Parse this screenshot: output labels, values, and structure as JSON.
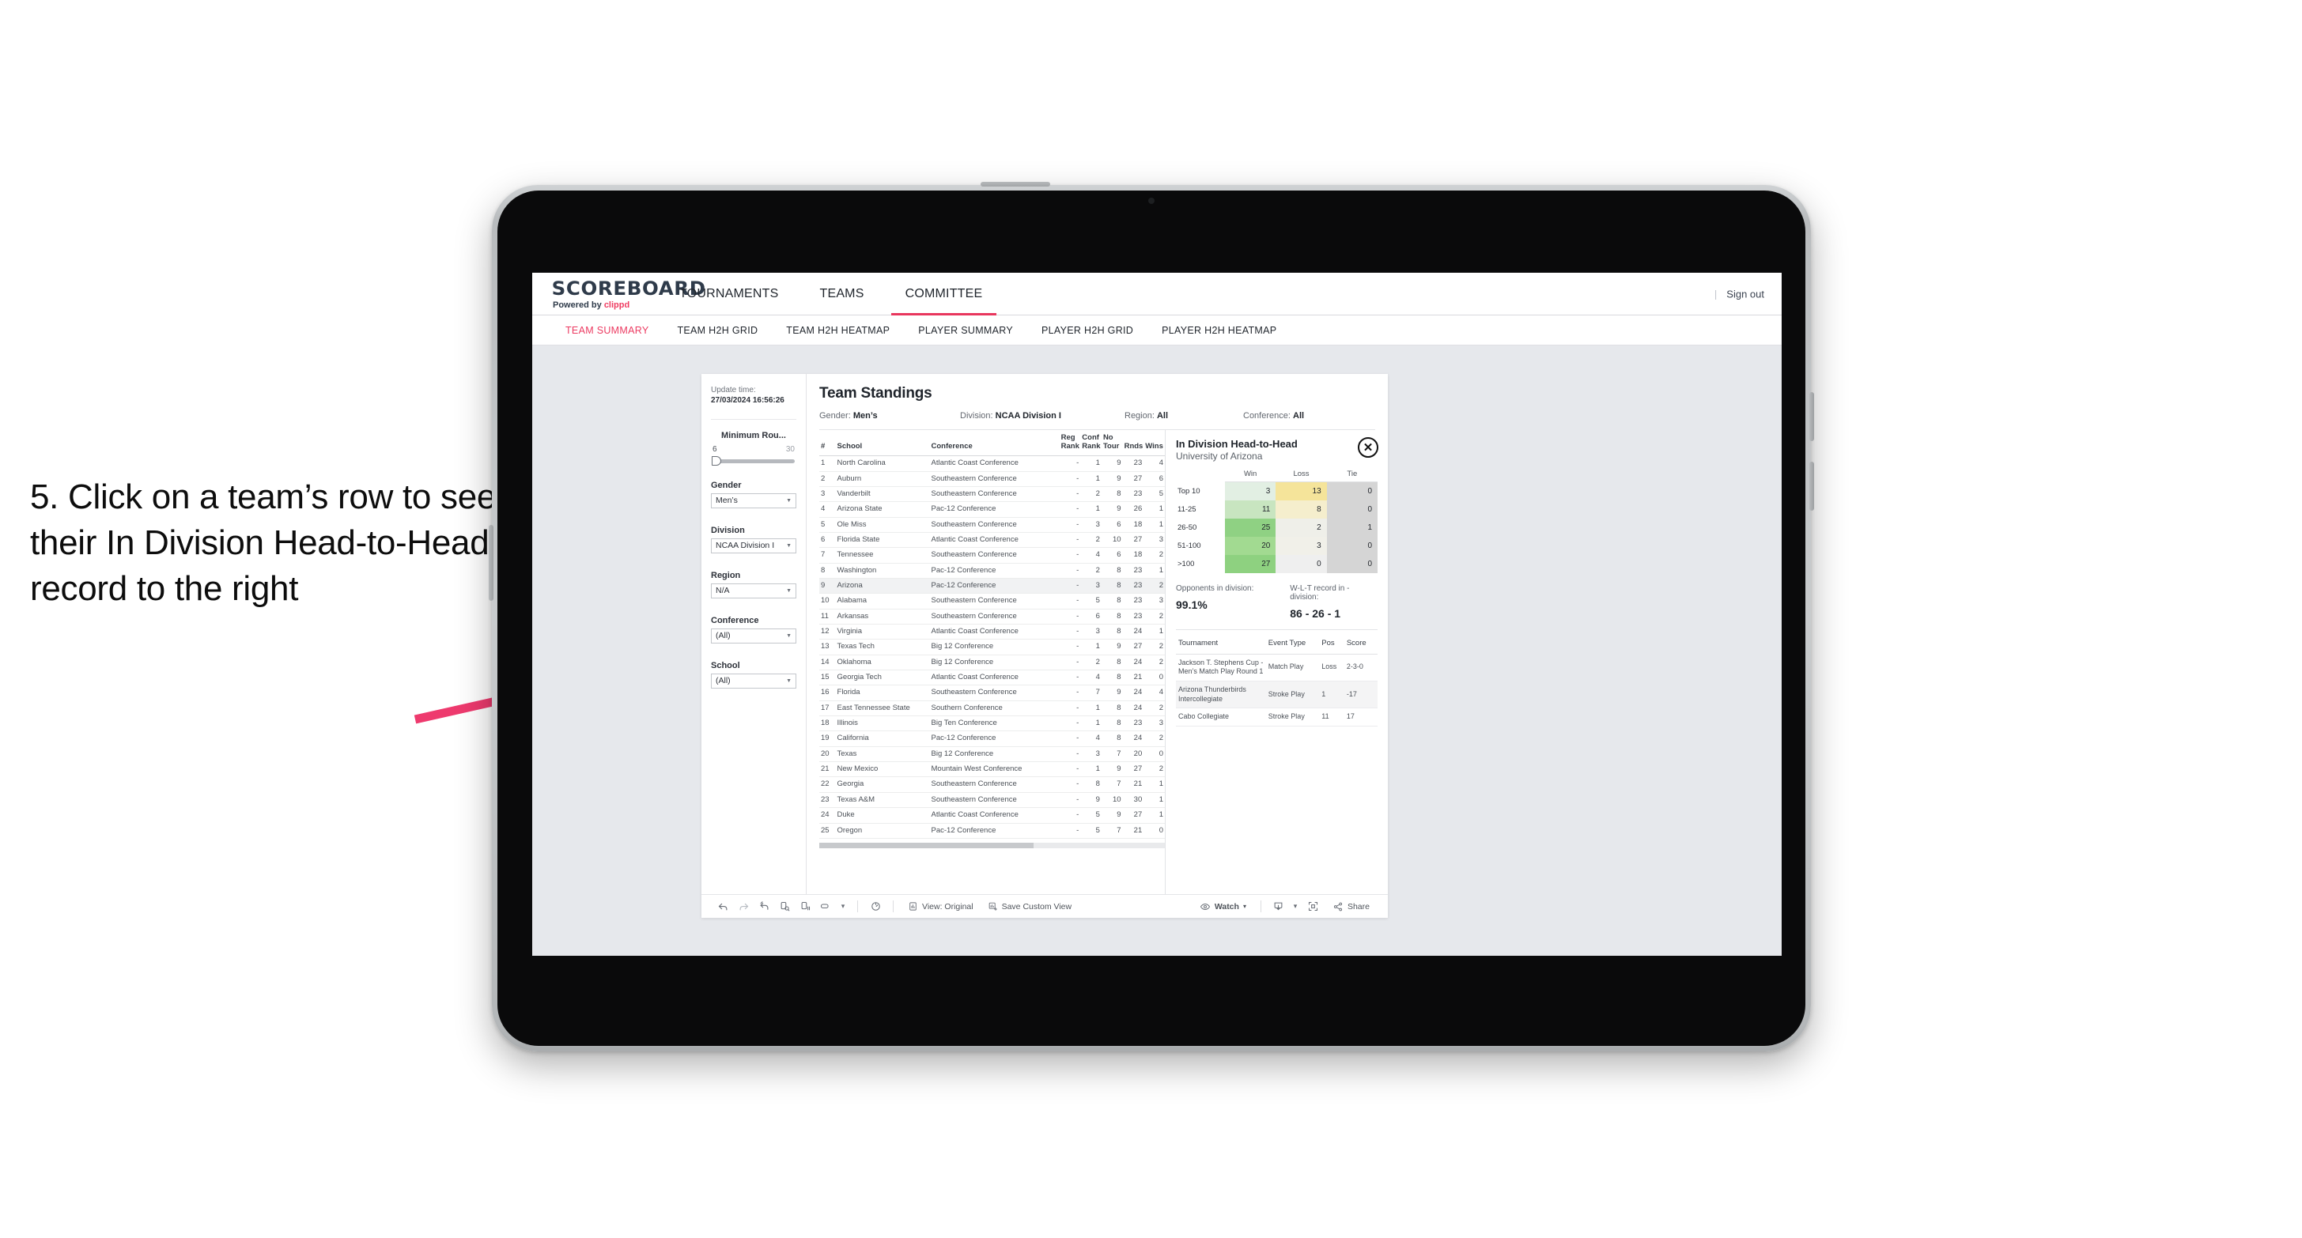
{
  "annotation": {
    "text": "5. Click on a team’s row to see their In Division Head-to-Head record to the right",
    "arrow_color": "#ee3a6e"
  },
  "topnav": {
    "logo_main": "SCOREBOARD",
    "logo_sub_pre": "Powered by",
    "logo_sub_brand": "clippd",
    "items": [
      {
        "label": "TOURNAMENTS",
        "active": false
      },
      {
        "label": "TEAMS",
        "active": false
      },
      {
        "label": "COMMITTEE",
        "active": true
      }
    ],
    "separator": "|",
    "signout": "Sign out",
    "accent": "#e8365d"
  },
  "subnav": {
    "items": [
      {
        "label": "TEAM SUMMARY",
        "active": true
      },
      {
        "label": "TEAM H2H GRID",
        "active": false
      },
      {
        "label": "TEAM H2H HEATMAP",
        "active": false
      },
      {
        "label": "PLAYER SUMMARY",
        "active": false
      },
      {
        "label": "PLAYER H2H GRID",
        "active": false
      },
      {
        "label": "PLAYER H2H HEATMAP",
        "active": false
      }
    ]
  },
  "filters": {
    "update_label": "Update time:",
    "update_value": "27/03/2024 16:56:26",
    "slider": {
      "title": "Minimum Rou...",
      "min": "6",
      "max": "30"
    },
    "groups": [
      {
        "label": "Gender",
        "value": "Men’s"
      },
      {
        "label": "Division",
        "value": "NCAA Division I"
      },
      {
        "label": "Region",
        "value": "N/A"
      },
      {
        "label": "Conference",
        "value": "(All)"
      },
      {
        "label": "School",
        "value": "(All)"
      }
    ]
  },
  "standings": {
    "title": "Team Standings",
    "meta": [
      {
        "label": "Gender:",
        "value": "Men’s"
      },
      {
        "label": "Division:",
        "value": "NCAA Division I"
      },
      {
        "label": "Region:",
        "value": "All"
      },
      {
        "label": "Conference:",
        "value": "All"
      }
    ],
    "columns": [
      "#",
      "School",
      "Conference",
      "Reg Rank",
      "Conf Rank",
      "No Tour",
      "Rnds",
      "Wins"
    ],
    "selected_row_index": 8,
    "rows": [
      {
        "num": "1",
        "school": "North Carolina",
        "conference": "Atlantic Coast Conference",
        "reg": "-",
        "conf": "1",
        "notour": "9",
        "rnds": "23",
        "wins": "4"
      },
      {
        "num": "2",
        "school": "Auburn",
        "conference": "Southeastern Conference",
        "reg": "-",
        "conf": "1",
        "notour": "9",
        "rnds": "27",
        "wins": "6"
      },
      {
        "num": "3",
        "school": "Vanderbilt",
        "conference": "Southeastern Conference",
        "reg": "-",
        "conf": "2",
        "notour": "8",
        "rnds": "23",
        "wins": "5"
      },
      {
        "num": "4",
        "school": "Arizona State",
        "conference": "Pac-12 Conference",
        "reg": "-",
        "conf": "1",
        "notour": "9",
        "rnds": "26",
        "wins": "1"
      },
      {
        "num": "5",
        "school": "Ole Miss",
        "conference": "Southeastern Conference",
        "reg": "-",
        "conf": "3",
        "notour": "6",
        "rnds": "18",
        "wins": "1"
      },
      {
        "num": "6",
        "school": "Florida State",
        "conference": "Atlantic Coast Conference",
        "reg": "-",
        "conf": "2",
        "notour": "10",
        "rnds": "27",
        "wins": "3"
      },
      {
        "num": "7",
        "school": "Tennessee",
        "conference": "Southeastern Conference",
        "reg": "-",
        "conf": "4",
        "notour": "6",
        "rnds": "18",
        "wins": "2"
      },
      {
        "num": "8",
        "school": "Washington",
        "conference": "Pac-12 Conference",
        "reg": "-",
        "conf": "2",
        "notour": "8",
        "rnds": "23",
        "wins": "1"
      },
      {
        "num": "9",
        "school": "Arizona",
        "conference": "Pac-12 Conference",
        "reg": "-",
        "conf": "3",
        "notour": "8",
        "rnds": "23",
        "wins": "2"
      },
      {
        "num": "10",
        "school": "Alabama",
        "conference": "Southeastern Conference",
        "reg": "-",
        "conf": "5",
        "notour": "8",
        "rnds": "23",
        "wins": "3"
      },
      {
        "num": "11",
        "school": "Arkansas",
        "conference": "Southeastern Conference",
        "reg": "-",
        "conf": "6",
        "notour": "8",
        "rnds": "23",
        "wins": "2"
      },
      {
        "num": "12",
        "school": "Virginia",
        "conference": "Atlantic Coast Conference",
        "reg": "-",
        "conf": "3",
        "notour": "8",
        "rnds": "24",
        "wins": "1"
      },
      {
        "num": "13",
        "school": "Texas Tech",
        "conference": "Big 12 Conference",
        "reg": "-",
        "conf": "1",
        "notour": "9",
        "rnds": "27",
        "wins": "2"
      },
      {
        "num": "14",
        "school": "Oklahoma",
        "conference": "Big 12 Conference",
        "reg": "-",
        "conf": "2",
        "notour": "8",
        "rnds": "24",
        "wins": "2"
      },
      {
        "num": "15",
        "school": "Georgia Tech",
        "conference": "Atlantic Coast Conference",
        "reg": "-",
        "conf": "4",
        "notour": "8",
        "rnds": "21",
        "wins": "0"
      },
      {
        "num": "16",
        "school": "Florida",
        "conference": "Southeastern Conference",
        "reg": "-",
        "conf": "7",
        "notour": "9",
        "rnds": "24",
        "wins": "4"
      },
      {
        "num": "17",
        "school": "East Tennessee State",
        "conference": "Southern Conference",
        "reg": "-",
        "conf": "1",
        "notour": "8",
        "rnds": "24",
        "wins": "2"
      },
      {
        "num": "18",
        "school": "Illinois",
        "conference": "Big Ten Conference",
        "reg": "-",
        "conf": "1",
        "notour": "8",
        "rnds": "23",
        "wins": "3"
      },
      {
        "num": "19",
        "school": "California",
        "conference": "Pac-12 Conference",
        "reg": "-",
        "conf": "4",
        "notour": "8",
        "rnds": "24",
        "wins": "2"
      },
      {
        "num": "20",
        "school": "Texas",
        "conference": "Big 12 Conference",
        "reg": "-",
        "conf": "3",
        "notour": "7",
        "rnds": "20",
        "wins": "0"
      },
      {
        "num": "21",
        "school": "New Mexico",
        "conference": "Mountain West Conference",
        "reg": "-",
        "conf": "1",
        "notour": "9",
        "rnds": "27",
        "wins": "2"
      },
      {
        "num": "22",
        "school": "Georgia",
        "conference": "Southeastern Conference",
        "reg": "-",
        "conf": "8",
        "notour": "7",
        "rnds": "21",
        "wins": "1"
      },
      {
        "num": "23",
        "school": "Texas A&M",
        "conference": "Southeastern Conference",
        "reg": "-",
        "conf": "9",
        "notour": "10",
        "rnds": "30",
        "wins": "1"
      },
      {
        "num": "24",
        "school": "Duke",
        "conference": "Atlantic Coast Conference",
        "reg": "-",
        "conf": "5",
        "notour": "9",
        "rnds": "27",
        "wins": "1"
      },
      {
        "num": "25",
        "school": "Oregon",
        "conference": "Pac-12 Conference",
        "reg": "-",
        "conf": "5",
        "notour": "7",
        "rnds": "21",
        "wins": "0"
      }
    ]
  },
  "detail": {
    "title": "In Division Head-to-Head",
    "subtitle": "University of Arizona",
    "close_icon": "close-icon",
    "h2h": {
      "columns": [
        "",
        "Win",
        "Loss",
        "Tie"
      ],
      "rows": [
        {
          "bucket": "Top 10",
          "win": "3",
          "loss": "13",
          "tie": "0",
          "win_color": "#e2efe3",
          "loss_color": "#f5e49a",
          "tie_color": "#d5d5d5"
        },
        {
          "bucket": "11-25",
          "win": "11",
          "loss": "8",
          "tie": "0",
          "win_color": "#c8e5c0",
          "loss_color": "#f5eecd",
          "tie_color": "#d5d5d5"
        },
        {
          "bucket": "26-50",
          "win": "25",
          "loss": "2",
          "tie": "1",
          "win_color": "#8fd183",
          "loss_color": "#efefe9",
          "tie_color": "#d5d5d5"
        },
        {
          "bucket": "51-100",
          "win": "20",
          "loss": "3",
          "tie": "0",
          "win_color": "#a2da91",
          "loss_color": "#f1f0e9",
          "tie_color": "#d5d5d5"
        },
        {
          "bucket": ">100",
          "win": "27",
          "loss": "0",
          "tie": "0",
          "win_color": "#8ed180",
          "loss_color": "#efefef",
          "tie_color": "#d5d5d5"
        }
      ]
    },
    "stats": [
      {
        "label": "Opponents in division:",
        "value": "99.1%"
      },
      {
        "label": "W-L-T record in -division:",
        "value": "86 - 26 - 1"
      }
    ],
    "tournaments": {
      "columns": [
        "Tournament",
        "Event Type",
        "Pos",
        "Score"
      ],
      "rows": [
        {
          "name": "Jackson T. Stephens Cup - Men’s Match Play Round 1",
          "type": "Match Play",
          "pos": "Loss",
          "score": "2-3-0"
        },
        {
          "name": "Arizona Thunderbirds Intercollegiate",
          "type": "Stroke Play",
          "pos": "1",
          "score": "-17"
        },
        {
          "name": "Cabo Collegiate",
          "type": "Stroke Play",
          "pos": "11",
          "score": "17"
        }
      ]
    }
  },
  "toolbar": {
    "icons": [
      "undo-icon",
      "redo-icon",
      "revert-icon",
      "refresh-data-icon",
      "pause-autoupdate-icon",
      "custom-views-icon"
    ],
    "dropdown_caret": "▾",
    "divider": "|",
    "view_label": "View: Original",
    "save_label": "Save Custom View",
    "watch_label": "Watch",
    "share_label": "Share",
    "alert_icon": "alert-icon",
    "download_icon": "download-icon",
    "fullscreen_icon": "fullscreen-icon"
  }
}
